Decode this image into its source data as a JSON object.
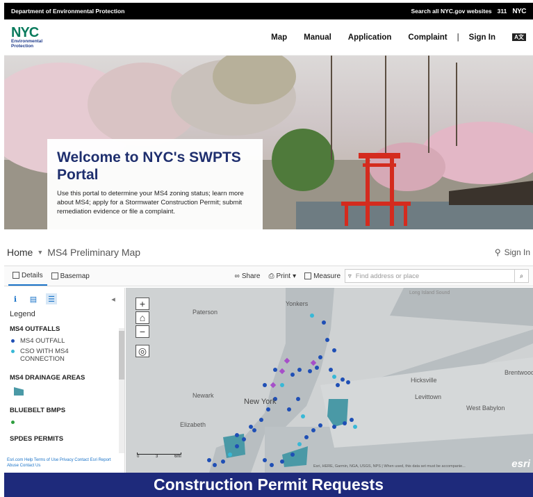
{
  "gov_bar": {
    "department": "Department of Environmental Protection",
    "search_all": "Search all NYC.gov websites",
    "phone": "311",
    "nyc_logo": "NYC"
  },
  "header": {
    "logo_main": "NYC",
    "logo_sub": "Environmental\nProtection",
    "nav": [
      "Map",
      "Manual",
      "Application",
      "Complaint"
    ],
    "separator": "|",
    "sign_in": "Sign In",
    "translate_icon": "translate-icon"
  },
  "hero": {
    "title": "Welcome to NYC's SWPTS Portal",
    "text": "Use this portal to determine your MS4 zoning status; learn more about MS4; apply for a Stormwater Construction Permit; submit remediation evidence or file a complaint."
  },
  "app": {
    "home": "Home",
    "title": "MS4 Preliminary Map",
    "sign_in": "Sign In",
    "toolbar": {
      "details": "Details",
      "basemap": "Basemap",
      "share": "Share",
      "print": "Print",
      "measure": "Measure",
      "search_placeholder": "Find address or place"
    },
    "legend": {
      "heading": "Legend",
      "sections": [
        {
          "title": "MS4 OUTFALLS",
          "items": [
            {
              "label": "MS4 OUTFALL",
              "color": "#1f4fb5"
            },
            {
              "label": "CSO WITH MS4 CONNECTION",
              "color": "#38b8d6"
            }
          ]
        },
        {
          "title": "MS4 DRAINAGE AREAS",
          "items": []
        },
        {
          "title": "BLUEBELT BMPS",
          "items": [
            {
              "label": "",
              "color": "#2e9e3e"
            }
          ]
        },
        {
          "title": "SPDES PERMITS",
          "items": []
        }
      ],
      "footer": "Esri.com  Help  Terms of Use  Privacy  Contact Esri  Report Abuse  Contact Us"
    },
    "map": {
      "places": [
        "Yonkers",
        "Paterson",
        "Newark",
        "New York",
        "Elizabeth",
        "Hicksville",
        "Levittown",
        "West Babylon",
        "Brentwood",
        "Long Island Sound"
      ],
      "attribution": "Esri, HERE, Garmin, NGA, USGS, NPS | When used, this data set must be accompanie...",
      "esri": "esri",
      "scale": [
        "0",
        "3",
        "6mi"
      ]
    }
  },
  "banner": "Construction Permit Requests"
}
